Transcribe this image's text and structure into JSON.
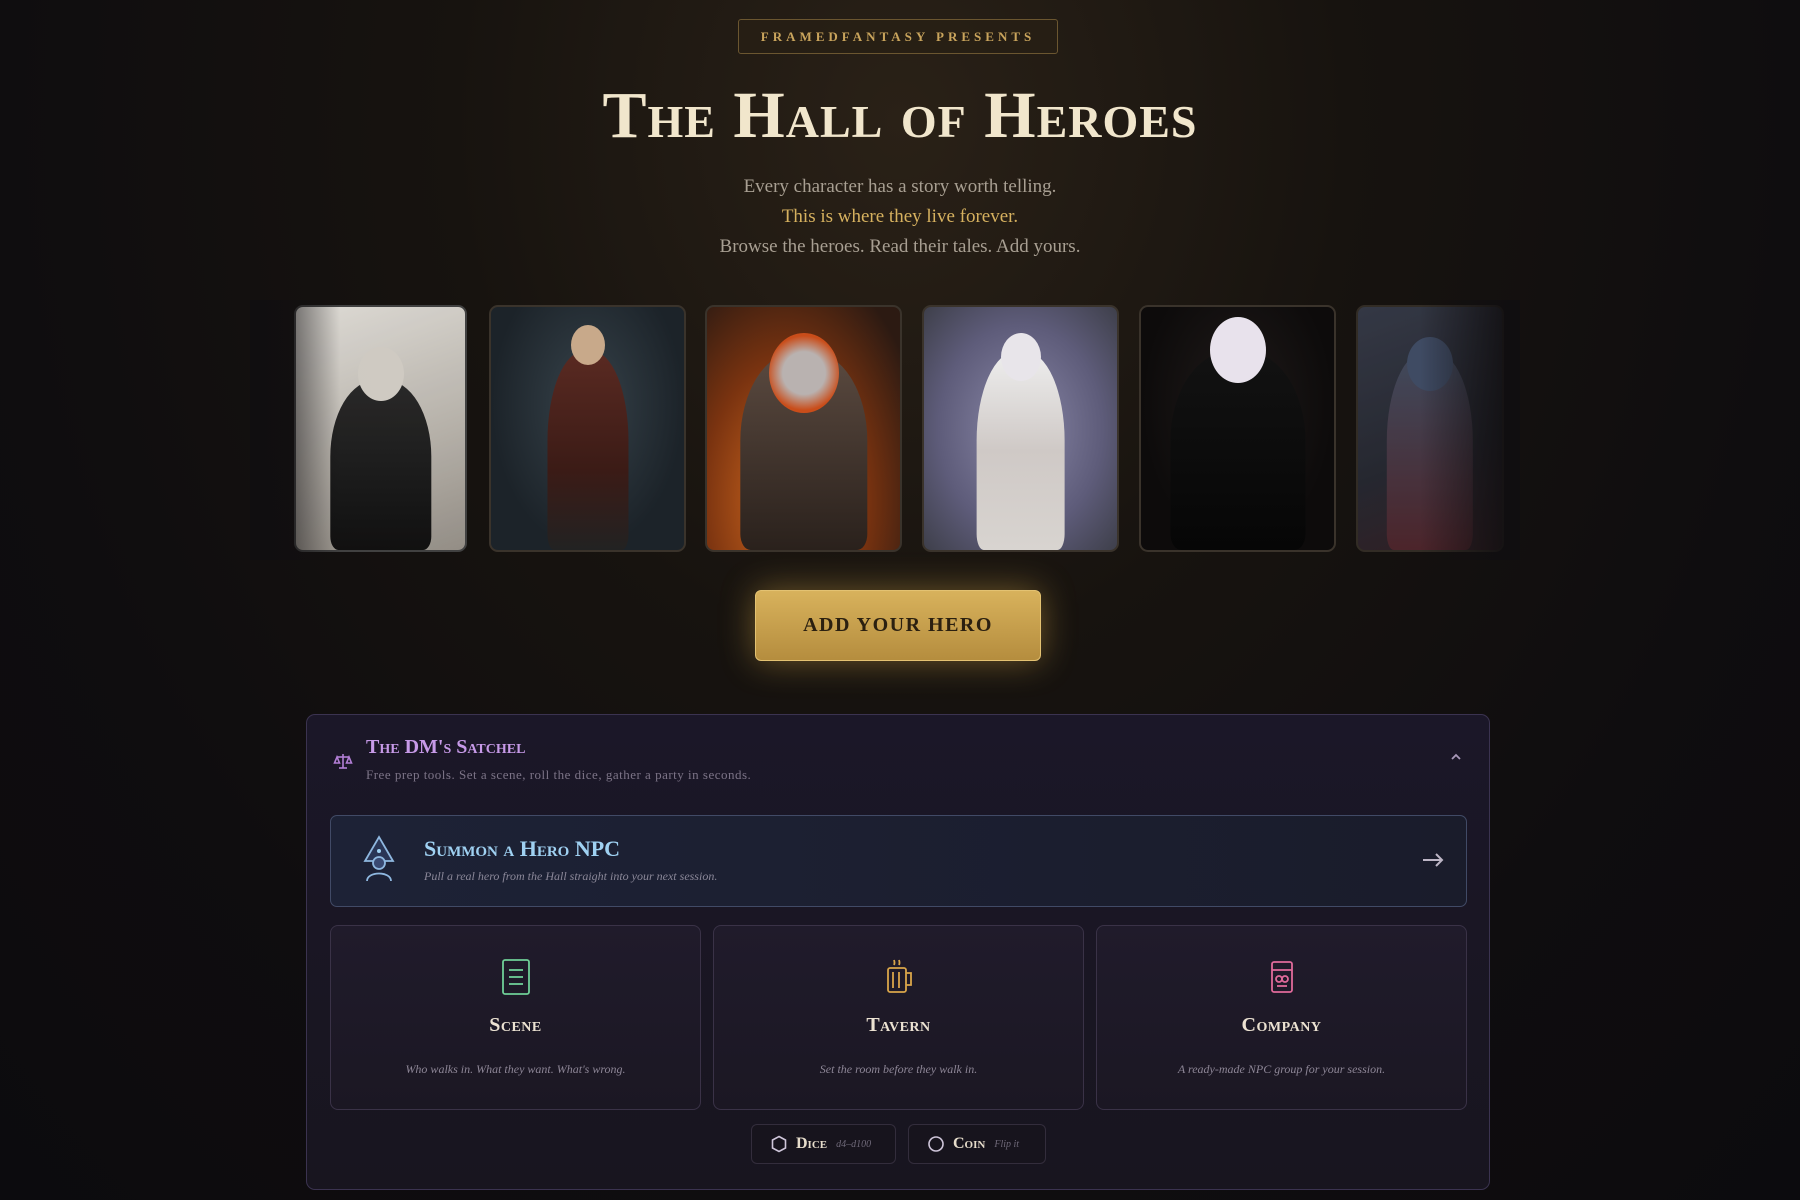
{
  "header": {
    "badge": "FRAMEDFANTASY PRESENTS",
    "title": "The Hall of Heroes",
    "subtitle_1": "Every character has a story worth telling.",
    "subtitle_2": "This is where they live forever.",
    "subtitle_3": "Browse the heroes. Read their tales. Add yours."
  },
  "carousel": {
    "cards": [
      "hero-portrait-1",
      "hero-portrait-2",
      "hero-portrait-3",
      "hero-portrait-4",
      "hero-portrait-5",
      "hero-portrait-6"
    ]
  },
  "cta": {
    "label": "ADD YOUR HERO"
  },
  "satchel": {
    "title": "The DM's Satchel",
    "description": "Free prep tools. Set a scene, roll the dice, gather a party in seconds.",
    "summon": {
      "title": "Summon a Hero NPC",
      "description": "Pull a real hero from the Hall straight into your next session."
    },
    "tools": [
      {
        "name": "Scene",
        "description": "Who walks in. What they want. What's wrong.",
        "icon": "scroll-icon"
      },
      {
        "name": "Tavern",
        "description": "Set the room before they walk in.",
        "icon": "mug-icon"
      },
      {
        "name": "Company",
        "description": "A ready-made NPC group for your session.",
        "icon": "cards-icon"
      }
    ],
    "mini": [
      {
        "label": "Dice",
        "sub": "d4–d100",
        "icon": "hexagon-icon"
      },
      {
        "label": "Coin",
        "sub": "Flip it",
        "icon": "circle-icon"
      }
    ]
  },
  "colors": {
    "accent_gold": "#d8b25c",
    "satchel_purple": "#c79ae8",
    "summon_blue": "#9fd1f2"
  }
}
